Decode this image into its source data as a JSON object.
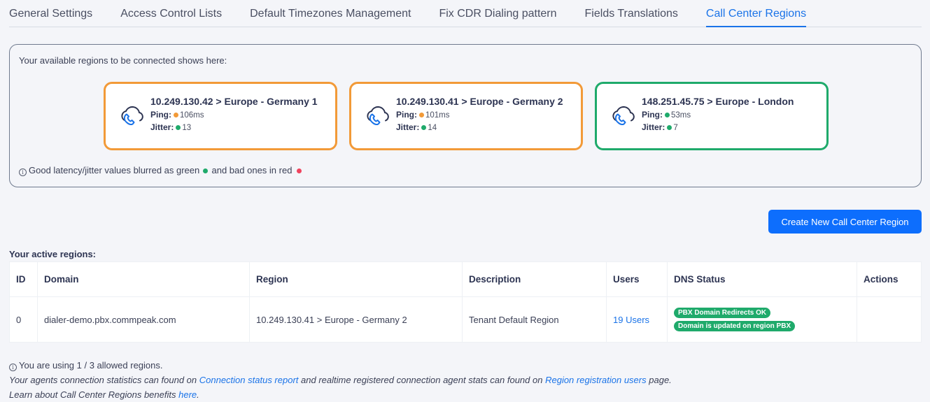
{
  "tabs": [
    {
      "label": "General Settings",
      "active": false
    },
    {
      "label": "Access Control Lists",
      "active": false
    },
    {
      "label": "Default Timezones Management",
      "active": false
    },
    {
      "label": "Fix CDR Dialing pattern",
      "active": false
    },
    {
      "label": "Fields Translations",
      "active": false
    },
    {
      "label": "Call Center Regions",
      "active": true
    }
  ],
  "available_regions": {
    "intro": "Your available regions to be connected shows here:",
    "cards": [
      {
        "title": "10.249.130.42 > Europe - Germany 1",
        "ping_label": "Ping:",
        "ping": "106ms",
        "ping_status": "warn",
        "jitter_label": "Jitter:",
        "jitter": "13",
        "jitter_status": "good",
        "status": "warn",
        "icon": "cloud-phone-icon"
      },
      {
        "title": "10.249.130.41 > Europe - Germany 2",
        "ping_label": "Ping:",
        "ping": "101ms",
        "ping_status": "warn",
        "jitter_label": "Jitter:",
        "jitter": "14",
        "jitter_status": "good",
        "status": "warn",
        "icon": "cloud-phone-icon"
      },
      {
        "title": "148.251.45.75 > Europe - London",
        "ping_label": "Ping:",
        "ping": "53ms",
        "ping_status": "good",
        "jitter_label": "Jitter:",
        "jitter": "7",
        "jitter_status": "good",
        "status": "good",
        "icon": "cloud-phone-icon"
      }
    ],
    "note_part1": "Good latency/jitter values blurred as green",
    "note_part2": "and bad ones in red"
  },
  "colors": {
    "good": "#1faa6b",
    "warn": "#f29a38",
    "bad": "#f0435e",
    "accent": "#1a73e8",
    "button": "#0d6efd"
  },
  "create_button": "Create New Call Center Region",
  "active_regions": {
    "title": "Your active regions:",
    "columns": [
      "ID",
      "Domain",
      "Region",
      "Description",
      "Users",
      "DNS Status",
      "Actions"
    ],
    "rows": [
      {
        "id": "0",
        "domain": "dialer-demo.pbx.commpeak.com",
        "region": "10.249.130.41 > Europe - Germany 2",
        "description": "Tenant Default Region",
        "users": "19 Users",
        "dns_status": [
          "PBX Domain Redirects OK",
          "Domain is updated on region PBX"
        ],
        "actions": ""
      }
    ]
  },
  "footer": {
    "usage": "You are using 1 / 3 allowed regions.",
    "stats_part1": "Your agents connection statistics can found on",
    "stats_link1": "Connection status report",
    "stats_part2": "and realtime registered connection agent stats can found on",
    "stats_link2": "Region registration users",
    "stats_part3": "page.",
    "learn_text": "Learn about Call Center Regions benefits",
    "learn_link": "here",
    "learn_end": "."
  }
}
